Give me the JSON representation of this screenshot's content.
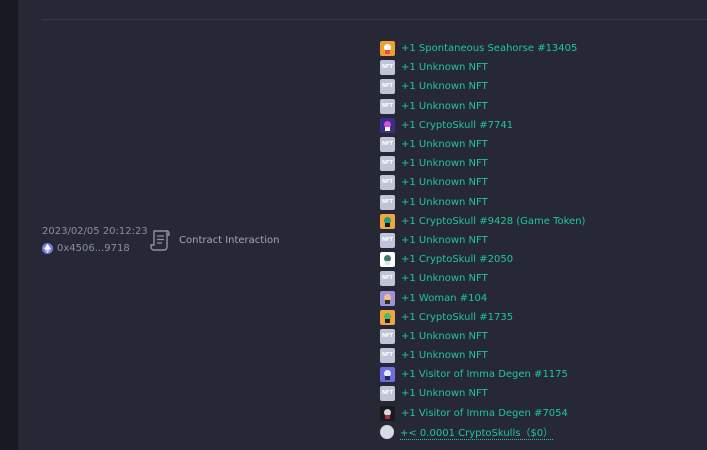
{
  "transaction": {
    "timestamp": "2023/02/05 20:12:23",
    "address": "0x4506...9718",
    "type_label": "Contract Interaction",
    "icons": {
      "chain": "ethereum-icon",
      "type": "scroll-icon"
    }
  },
  "events": [
    {
      "thumb": "seahorse",
      "label": "+1 Spontaneous Seahorse #13405"
    },
    {
      "thumb": "nft",
      "label": "+1 Unknown NFT"
    },
    {
      "thumb": "nft",
      "label": "+1 Unknown NFT"
    },
    {
      "thumb": "nft",
      "label": "+1 Unknown NFT"
    },
    {
      "thumb": "skull-purple",
      "label": "+1 CryptoSkull #7741"
    },
    {
      "thumb": "nft",
      "label": "+1 Unknown NFT"
    },
    {
      "thumb": "nft",
      "label": "+1 Unknown NFT"
    },
    {
      "thumb": "nft",
      "label": "+1 Unknown NFT"
    },
    {
      "thumb": "nft",
      "label": "+1 Unknown NFT"
    },
    {
      "thumb": "skull-teal",
      "label": "+1 CryptoSkull #9428 (Game Token)"
    },
    {
      "thumb": "nft",
      "label": "+1 Unknown NFT"
    },
    {
      "thumb": "skull-white",
      "label": "+1 CryptoSkull #2050"
    },
    {
      "thumb": "nft",
      "label": "+1 Unknown NFT"
    },
    {
      "thumb": "woman",
      "label": "+1 Woman #104"
    },
    {
      "thumb": "skull-orange",
      "label": "+1 CryptoSkull #1735"
    },
    {
      "thumb": "nft",
      "label": "+1 Unknown NFT"
    },
    {
      "thumb": "nft",
      "label": "+1 Unknown NFT"
    },
    {
      "thumb": "visitor-purple",
      "label": "+1 Visitor of Imma Degen #1175"
    },
    {
      "thumb": "nft",
      "label": "+1 Unknown NFT"
    },
    {
      "thumb": "visitor-dark",
      "label": "+1 Visitor of Imma Degen #7054"
    },
    {
      "thumb": "coin",
      "label": "+< 0.0001 CryptoSkulls（$0）",
      "link": true
    }
  ],
  "nft_placeholder_text": "NFT",
  "colors": {
    "incoming_text": "#1fc69a",
    "muted_text": "#8a8e9c",
    "panel_bg": "#262935",
    "page_bg": "#1c1e26"
  }
}
